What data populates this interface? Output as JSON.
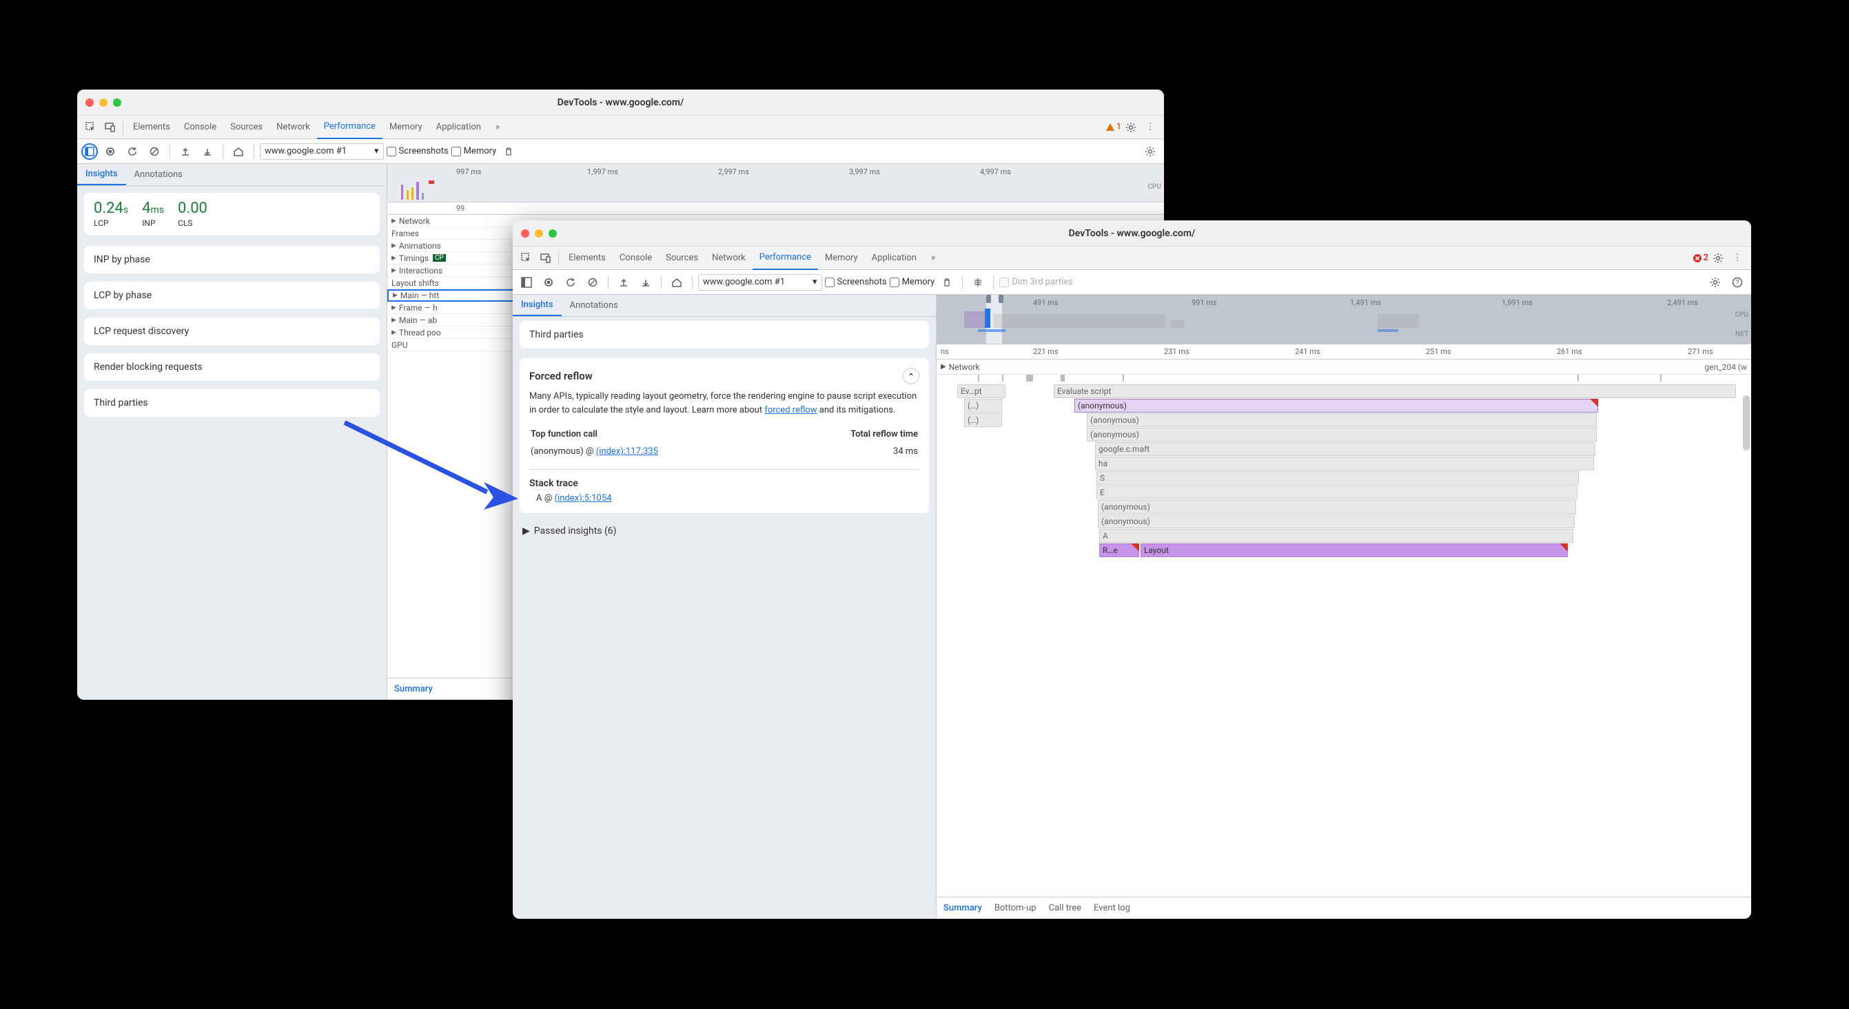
{
  "window1": {
    "title": "DevTools - www.google.com/",
    "tabs": [
      "Elements",
      "Console",
      "Sources",
      "Network",
      "Performance",
      "Memory",
      "Application"
    ],
    "active_tab": "Performance",
    "warn_count": "1",
    "url_select": "www.google.com #1",
    "chk_screenshots": "Screenshots",
    "chk_memory": "Memory",
    "subtabs": [
      "Insights",
      "Annotations"
    ],
    "active_subtab": "Insights",
    "metrics": {
      "lcp_val": "0.24",
      "lcp_unit": "s",
      "lcp_lbl": "LCP",
      "inp_val": "4",
      "inp_unit": "ms",
      "inp_lbl": "INP",
      "cls_val": "0.00",
      "cls_lbl": "CLS"
    },
    "insights": [
      "INP by phase",
      "LCP by phase",
      "LCP request discovery",
      "Render blocking requests",
      "Third parties"
    ],
    "ruler": [
      "997 ms",
      "1,997 ms",
      "2,997 ms",
      "3,997 ms",
      "4,997 ms"
    ],
    "ruler2_val": "99",
    "tracks": [
      "Network",
      "Frames",
      "Animations",
      "Timings",
      "Interactions",
      "Layout shifts",
      "Main — htt",
      "Frame — h",
      "Main — ab",
      "Thread poo",
      "GPU"
    ],
    "timings_badge": "CP",
    "footer_tab": "Summary",
    "cpu_label": "CPU"
  },
  "window2": {
    "title": "DevTools - www.google.com/",
    "tabs": [
      "Elements",
      "Console",
      "Sources",
      "Network",
      "Performance",
      "Memory",
      "Application"
    ],
    "active_tab": "Performance",
    "err_count": "2",
    "url_select": "www.google.com #1",
    "chk_screenshots": "Screenshots",
    "chk_memory": "Memory",
    "dim_third": "Dim 3rd parties",
    "subtabs": [
      "Insights",
      "Annotations"
    ],
    "active_subtab": "Insights",
    "third_parties_card": "Third parties",
    "forced_reflow": {
      "title": "Forced reflow",
      "body_pre": "Many APIs, typically reading layout geometry, force the rendering engine to pause script execution in order to calculate the style and layout. Learn more about ",
      "link": "forced reflow",
      "body_post": " and its mitigations.",
      "col1": "Top function call",
      "col2": "Total reflow time",
      "row1a": "(anonymous) @ ",
      "row1a_link": "(index):117:335",
      "row1b": "34 ms",
      "stack_trace": "Stack trace",
      "stack_a": "A @ ",
      "stack_link": "(index):5:1054"
    },
    "passed": "Passed insights (6)",
    "overview_ruler": [
      "491 ms",
      "991 ms",
      "1,491 ms",
      "1,991 ms",
      "2,491 ms"
    ],
    "detail_ruler_partial": "ns",
    "detail_ruler": [
      "221 ms",
      "231 ms",
      "241 ms",
      "251 ms",
      "261 ms",
      "271 ms"
    ],
    "net_track": "Network",
    "net_item": "gen_204 (w",
    "flame": {
      "evpt": "Ev…pt",
      "dots": "(…)",
      "evalscript": "Evaluate script",
      "anon": "(anonymous)",
      "maft": "google.c.maft",
      "ha": "ha",
      "S": "S",
      "E": "E",
      "A": "A",
      "re": "R…e",
      "layout": "Layout"
    },
    "footer_tabs": [
      "Summary",
      "Bottom-up",
      "Call tree",
      "Event log"
    ],
    "active_footer": "Summary",
    "cpu_label": "CPU",
    "net_label": "NET"
  }
}
